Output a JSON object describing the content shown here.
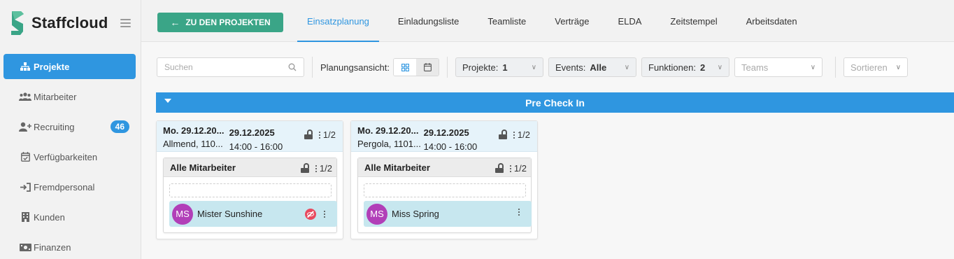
{
  "brand": {
    "name": "Staffcloud",
    "accent": "#2f96e0",
    "green": "#3aa587"
  },
  "sidebar": {
    "items": [
      {
        "label": "Projekte",
        "icon": "sitemap-icon",
        "active": true
      },
      {
        "label": "Mitarbeiter",
        "icon": "users-icon"
      },
      {
        "label": "Recruiting",
        "icon": "user-plus-icon",
        "badge": "46"
      },
      {
        "label": "Verfügbarkeiten",
        "icon": "calendar-check-icon"
      },
      {
        "label": "Fremdpersonal",
        "icon": "sign-in-icon"
      },
      {
        "label": "Kunden",
        "icon": "building-icon"
      },
      {
        "label": "Finanzen",
        "icon": "money-bill-icon"
      }
    ]
  },
  "header": {
    "back_label": "ZU DEN PROJEKTEN",
    "tabs": [
      "Einsatzplanung",
      "Einladungsliste",
      "Teamliste",
      "Verträge",
      "ELDA",
      "Zeitstempel",
      "Arbeitsdaten"
    ],
    "active_tab": "Einsatzplanung"
  },
  "filters": {
    "search_placeholder": "Suchen",
    "plan_label": "Planungsansicht:",
    "projekte": {
      "label": "Projekte:",
      "value": "1"
    },
    "events": {
      "label": "Events:",
      "value": "Alle"
    },
    "funktionen": {
      "label": "Funktionen:",
      "value": "2"
    },
    "teams_placeholder": "Teams",
    "sort_placeholder": "Sortieren"
  },
  "phase": {
    "title": "Pre Check In"
  },
  "cards": [
    {
      "date_start": "Mo. 29.12.20...",
      "date_end": "29.12.2025",
      "location": "Allmend, 110...",
      "time": "14:00 - 16:00",
      "count": "1/2",
      "group": {
        "title": "Alle Mitarbeiter",
        "count": "1/2"
      },
      "member": {
        "initials": "MS",
        "name": "Mister Sunshine",
        "hidden": true
      }
    },
    {
      "date_start": "Mo. 29.12.20...",
      "date_end": "29.12.2025",
      "location": "Pergola, 1101...",
      "time": "14:00 - 16:00",
      "count": "1/2",
      "group": {
        "title": "Alle Mitarbeiter",
        "count": "1/2"
      },
      "member": {
        "initials": "MS",
        "name": "Miss Spring",
        "hidden": false
      }
    }
  ]
}
